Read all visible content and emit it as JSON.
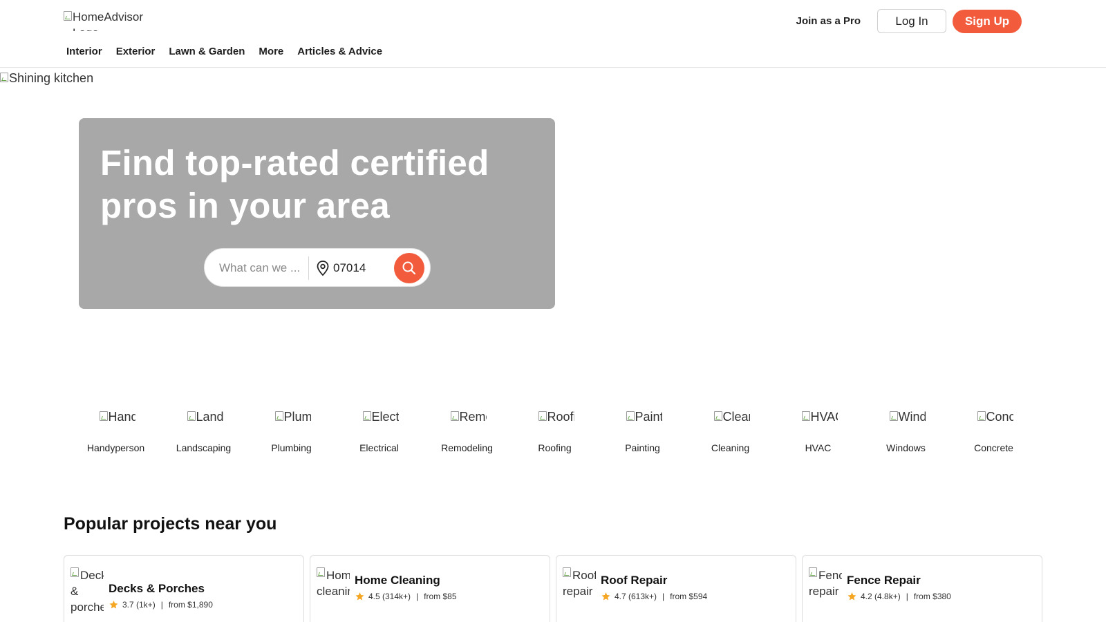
{
  "header": {
    "logo_alt": "HomeAdvisor Logo",
    "join_pro": "Join as a Pro",
    "login": "Log In",
    "signup": "Sign Up"
  },
  "nav": {
    "items": [
      "Interior",
      "Exterior",
      "Lawn & Garden",
      "More",
      "Articles & Advice"
    ]
  },
  "hero": {
    "image_alt": "Shining kitchen",
    "title": "Find top-rated certified pros in your area",
    "search_placeholder": "What can we ...",
    "zip_value": "07014"
  },
  "categories": [
    {
      "alt": "Handyperson",
      "label": "Handyperson"
    },
    {
      "alt": "Landscaping",
      "label": "Landscaping"
    },
    {
      "alt": "Plumbing",
      "label": "Plumbing"
    },
    {
      "alt": "Electrical",
      "label": "Electrical"
    },
    {
      "alt": "Remodeling",
      "label": "Remodeling"
    },
    {
      "alt": "Roofing",
      "label": "Roofing"
    },
    {
      "alt": "Painting",
      "label": "Painting"
    },
    {
      "alt": "Cleaning",
      "label": "Cleaning"
    },
    {
      "alt": "HVAC",
      "label": "HVAC"
    },
    {
      "alt": "Windows",
      "label": "Windows"
    },
    {
      "alt": "Concrete",
      "label": "Concrete"
    }
  ],
  "popular": {
    "title": "Popular projects near you",
    "projects": [
      {
        "img_alt": "Decks & porches",
        "name": "Decks & Porches",
        "rating": "3.7 (1k+)",
        "price": "from $1,890"
      },
      {
        "img_alt": "Home cleaning",
        "name": "Home Cleaning",
        "rating": "4.5 (314k+)",
        "price": "from $85"
      },
      {
        "img_alt": "Roof repair",
        "name": "Roof Repair",
        "rating": "4.7 (613k+)",
        "price": "from $594"
      },
      {
        "img_alt": "Fence repair",
        "name": "Fence Repair",
        "rating": "4.2 (4.8k+)",
        "price": "from $380"
      }
    ]
  },
  "colors": {
    "brand_orange": "#f25c3d",
    "hero_card": "#a8a8a8",
    "star": "#f5a623"
  }
}
